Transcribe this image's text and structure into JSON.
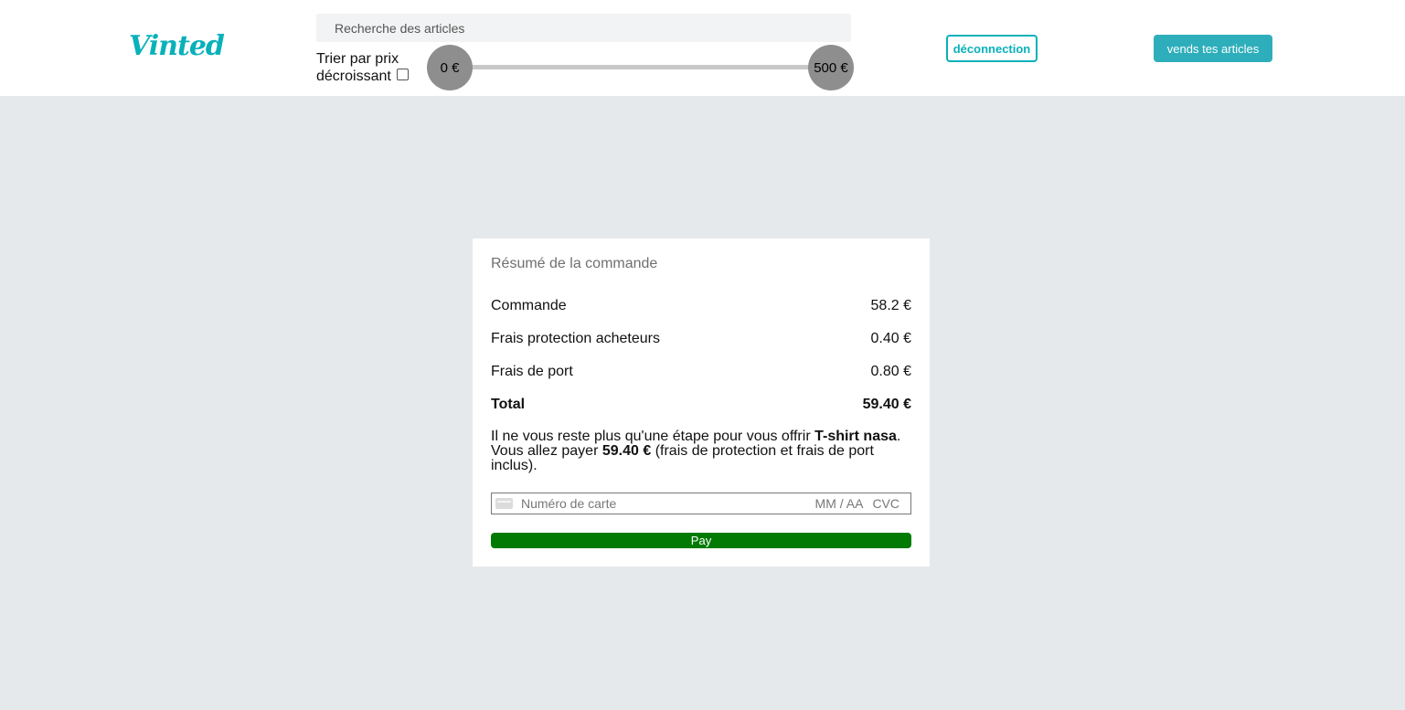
{
  "header": {
    "logo": "Vinted",
    "search_placeholder": "Recherche des articles",
    "sort_label": "Trier par prix décroissant",
    "price_min": "0 €",
    "price_max": "500 €",
    "logout_label": "déconnection",
    "sell_label": "vends tes articles"
  },
  "summary": {
    "title": "Résumé de la commande",
    "rows": [
      {
        "label": "Commande",
        "value": "58.2 €"
      },
      {
        "label": "Frais protection acheteurs",
        "value": "0.40 €"
      },
      {
        "label": "Frais de port",
        "value": "0.80 €"
      }
    ],
    "total": {
      "label": "Total",
      "value": "59.40 €"
    },
    "message": {
      "part1": "Il ne vous reste plus qu'une étape pour vous offrir ",
      "product": "T-shirt nasa",
      "part2": ". Vous allez payer ",
      "amount": "59.40 €",
      "part3": " (frais de protection et frais de port inclus)."
    }
  },
  "payment": {
    "card_number_placeholder": "Numéro de carte",
    "expiry_placeholder": "MM / AA",
    "cvc_placeholder": "CVC",
    "pay_label": "Pay"
  },
  "colors": {
    "brand": "#09b1ba",
    "pay_button": "#037a03",
    "background": "#e6e9ec"
  }
}
